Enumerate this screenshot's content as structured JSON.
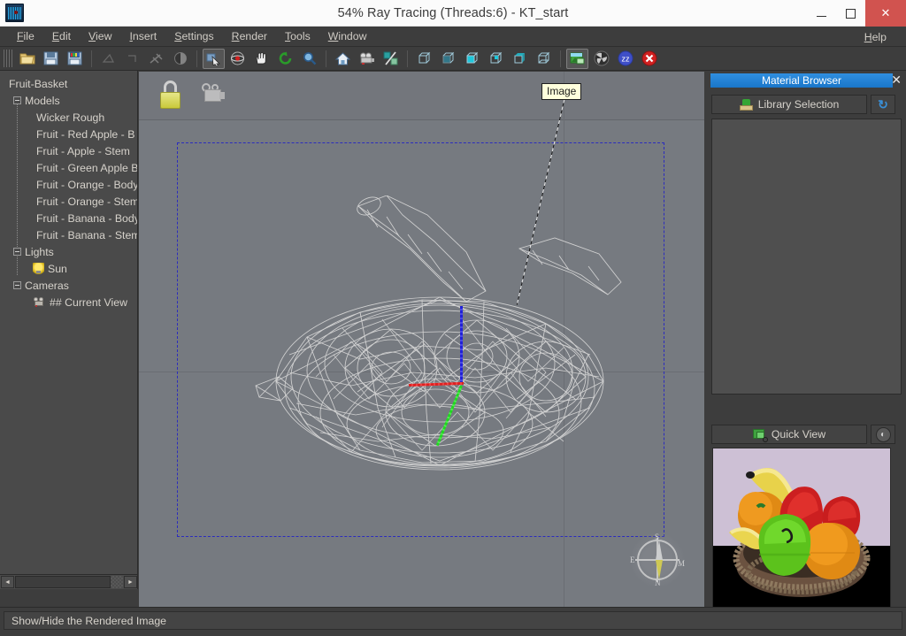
{
  "window": {
    "title": "54% Ray Tracing (Threads:6) - KT_start",
    "app_icon": "barcode-app-icon",
    "minimize": "–",
    "maximize": "□",
    "close": "✕"
  },
  "menubar": {
    "items": [
      {
        "label": "File",
        "mnemonic": "F"
      },
      {
        "label": "Edit",
        "mnemonic": "E"
      },
      {
        "label": "View",
        "mnemonic": "V"
      },
      {
        "label": "Insert",
        "mnemonic": "I"
      },
      {
        "label": "Settings",
        "mnemonic": "S"
      },
      {
        "label": "Render",
        "mnemonic": "R"
      },
      {
        "label": "Tools",
        "mnemonic": "T"
      },
      {
        "label": "Window",
        "mnemonic": "W"
      }
    ],
    "help": "Help"
  },
  "toolbar": {
    "groups": [
      {
        "buttons": [
          {
            "name": "open-file",
            "icon": "folder-open-icon",
            "state": "enabled"
          },
          {
            "name": "save-file",
            "icon": "floppy-save-icon",
            "state": "enabled"
          },
          {
            "name": "save-image",
            "icon": "floppy-color-save-icon",
            "state": "enabled"
          }
        ]
      },
      {
        "buttons": [
          {
            "name": "select-face",
            "icon": "face-select-icon",
            "state": "disabled"
          },
          {
            "name": "select-edge",
            "icon": "edge-select-icon",
            "state": "disabled"
          },
          {
            "name": "lightning",
            "icon": "lightning-icon",
            "state": "disabled"
          },
          {
            "name": "contrast",
            "icon": "half-circle-contrast-icon",
            "state": "disabled"
          }
        ]
      },
      {
        "buttons": [
          {
            "name": "pointer-select",
            "icon": "arrow-select-icon",
            "state": "active"
          },
          {
            "name": "orbit-target",
            "icon": "orbit-target-icon",
            "state": "enabled"
          },
          {
            "name": "pan-hand",
            "icon": "hand-pan-icon",
            "state": "enabled"
          },
          {
            "name": "rotate",
            "icon": "rotate-green-arrow-icon",
            "state": "enabled"
          },
          {
            "name": "zoom",
            "icon": "magnifier-icon",
            "state": "enabled"
          }
        ]
      },
      {
        "buttons": [
          {
            "name": "home-view",
            "icon": "home-icon",
            "state": "enabled"
          },
          {
            "name": "camera-view",
            "icon": "camera-icon",
            "state": "enabled"
          },
          {
            "name": "percent-tool",
            "icon": "percent-icon",
            "state": "enabled"
          }
        ]
      },
      {
        "buttons": [
          {
            "name": "view-box-1",
            "icon": "cube-wire-icon",
            "state": "enabled"
          },
          {
            "name": "view-box-2",
            "icon": "cube-bottom-icon",
            "state": "enabled"
          },
          {
            "name": "view-box-3",
            "icon": "cube-solid-icon",
            "state": "enabled"
          },
          {
            "name": "view-box-4",
            "icon": "cube-front-icon",
            "state": "enabled"
          },
          {
            "name": "view-box-5",
            "icon": "cube-shaded-icon",
            "state": "enabled"
          },
          {
            "name": "view-box-6",
            "icon": "cube-side-icon",
            "state": "enabled"
          }
        ]
      },
      {
        "buttons": [
          {
            "name": "show-hide-rendered-image",
            "icon": "image-render-icon",
            "state": "active"
          },
          {
            "name": "render-settings",
            "icon": "fan-dark-icon",
            "state": "enabled"
          },
          {
            "name": "pause-render",
            "icon": "zzz-sleep-icon",
            "state": "enabled"
          },
          {
            "name": "stop-render",
            "icon": "stop-red-x-icon",
            "state": "enabled"
          }
        ]
      }
    ]
  },
  "tree": {
    "root_label": "Fruit-Basket",
    "groups": [
      {
        "label": "Models",
        "expanded": true,
        "children": [
          "Wicker Rough",
          "Fruit - Red Apple - B",
          "Fruit - Apple - Stem",
          "Fruit - Green Apple B",
          "Fruit - Orange - Body",
          "Fruit - Orange - Stem",
          "Fruit - Banana - Body",
          "Fruit - Banana - Stem"
        ]
      },
      {
        "label": "Lights",
        "expanded": true,
        "children": [
          "Sun"
        ],
        "child_icon": "light-bulb-icon"
      },
      {
        "label": "Cameras",
        "expanded": true,
        "children": [
          "## Current View"
        ],
        "child_icon": "movie-camera-icon"
      }
    ],
    "scrollbar": {
      "left_arrow": "◄",
      "right_arrow": "►"
    }
  },
  "viewport": {
    "lock_icon": "padlock-icon",
    "camera_icon": "movie-camera-icon",
    "tooltip": "Image",
    "compass": {
      "north": "N",
      "south": "S",
      "east": "M",
      "west": "E"
    },
    "axis_gizmo": {
      "z_color": "#2020d8",
      "x_color": "#e02020",
      "y_color": "#20d820"
    },
    "selection_outline_color": "#2b2bbe",
    "background_color": "#767a80"
  },
  "material_browser": {
    "title": "Material Browser",
    "close": "✕",
    "library_button": "Library Selection",
    "library_icon": "library-box-icon",
    "refresh_icon": "refresh-icon"
  },
  "quick_view": {
    "button_label": "Quick View",
    "button_icon": "quick-view-icon",
    "side_icon": "fan-icon",
    "preview_alt": "fruit-basket-render-preview"
  },
  "statusbar": {
    "message": "Show/Hide the Rendered Image"
  }
}
